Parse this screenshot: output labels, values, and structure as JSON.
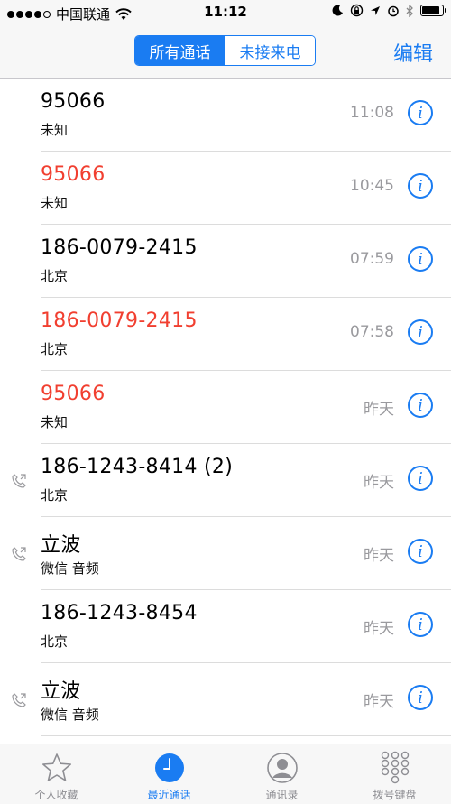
{
  "status_bar": {
    "carrier": "中国联通",
    "time": "11:12"
  },
  "nav": {
    "segments": [
      "所有通话",
      "未接来电"
    ],
    "active_segment": 0,
    "edit_label": "编辑"
  },
  "calls": [
    {
      "number": "95066",
      "subtitle": "未知",
      "time": "11:08",
      "missed": false,
      "outgoing": false
    },
    {
      "number": "95066",
      "subtitle": "未知",
      "time": "10:45",
      "missed": true,
      "outgoing": false
    },
    {
      "number": "186-0079-2415",
      "subtitle": "北京",
      "time": "07:59",
      "missed": false,
      "outgoing": false
    },
    {
      "number": "186-0079-2415",
      "subtitle": "北京",
      "time": "07:58",
      "missed": true,
      "outgoing": false
    },
    {
      "number": "95066",
      "subtitle": "未知",
      "time": "昨天",
      "missed": true,
      "outgoing": false
    },
    {
      "number": "186-1243-8414 (2)",
      "subtitle": "北京",
      "time": "昨天",
      "missed": false,
      "outgoing": true
    },
    {
      "number": "立波",
      "subtitle": "微信 音频",
      "time": "昨天",
      "missed": false,
      "outgoing": true
    },
    {
      "number": "186-1243-8454",
      "subtitle": "北京",
      "time": "昨天",
      "missed": false,
      "outgoing": false
    },
    {
      "number": "立波",
      "subtitle": "微信 音频",
      "time": "昨天",
      "missed": false,
      "outgoing": true
    }
  ],
  "tabs": [
    {
      "label": "个人收藏",
      "icon": "star-icon",
      "active": false
    },
    {
      "label": "最近通话",
      "icon": "clock-icon",
      "active": true
    },
    {
      "label": "通讯录",
      "icon": "contacts-icon",
      "active": false
    },
    {
      "label": "拨号键盘",
      "icon": "keypad-icon",
      "active": false
    }
  ],
  "colors": {
    "accent": "#1a7cf2",
    "missed": "#f13f30",
    "secondary_text": "#9a9a9e"
  }
}
